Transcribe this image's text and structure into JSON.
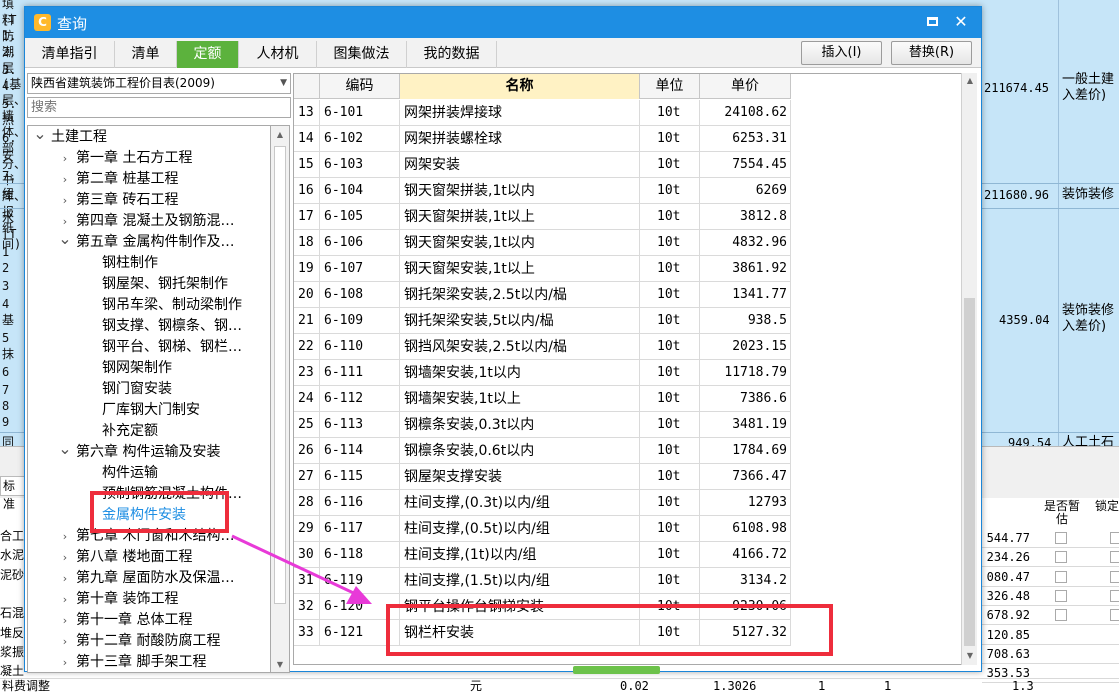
{
  "background": {
    "top_lines": [
      "填料防潮层(基层、墙体、部分、书库、报纸间)",
      "[T",
      "1.",
      "2.",
      "3.",
      "4.",
      "5.",
      "热",
      "6.",
      "安",
      "7.",
      "纽",
      "水",
      "[T",
      "1",
      "2",
      "3",
      "4",
      "基",
      "5",
      "抹",
      "6",
      "7",
      "8",
      "9",
      "同"
    ],
    "right_cells": [
      {
        "amount": "211674.45",
        "text": "一般土建\n入差价)"
      },
      {
        "amount": "211680.96",
        "text": "装饰装修"
      },
      {
        "amount": "4359.04",
        "text": "装饰装修\n入差价)"
      },
      {
        "amount": "949.54",
        "text": "人工土石"
      }
    ],
    "tab_label": "标准",
    "header_estimate": "是否暂\n估",
    "header_lock": "锁定",
    "lower_left": [
      "合工",
      "水泥",
      "泥砂",
      "",
      "石混",
      "堆反",
      "浆振",
      "凝土"
    ],
    "lower_amounts": [
      "544.77",
      "234.26",
      "080.47",
      "326.48",
      "678.92",
      "120.85",
      "708.63",
      "353.53"
    ],
    "bottom_row": {
      "name": "料费调整",
      "unit": "元",
      "qty": "0.02",
      "price": "1.3026",
      "c1": "1",
      "c2": "1",
      "end": "1.3"
    }
  },
  "dialog": {
    "title": "查询",
    "logo_glyph": "C",
    "minimize_glyph": "▭",
    "close_glyph": "✕",
    "tabs": [
      "清单指引",
      "清单",
      "定额",
      "人材机",
      "图集做法",
      "我的数据"
    ],
    "active_tab": "定额",
    "insert_label": "插入(I)",
    "replace_label": "替换(R)"
  },
  "left_panel": {
    "library": "陕西省建筑装饰工程价目表(2009)",
    "search_placeholder": "搜索",
    "tree": [
      {
        "label": "土建工程",
        "level": 0,
        "state": "open"
      },
      {
        "label": "第一章  土石方工程",
        "level": 1,
        "state": "closed"
      },
      {
        "label": "第二章  桩基工程",
        "level": 1,
        "state": "closed"
      },
      {
        "label": "第三章  砖石工程",
        "level": 1,
        "state": "closed"
      },
      {
        "label": "第四章  混凝土及钢筋混…",
        "level": 1,
        "state": "closed"
      },
      {
        "label": "第五章  金属构件制作及…",
        "level": 1,
        "state": "open"
      },
      {
        "label": "钢柱制作",
        "level": 2,
        "state": "leaf"
      },
      {
        "label": "钢屋架、钢托架制作",
        "level": 2,
        "state": "leaf"
      },
      {
        "label": "钢吊车梁、制动梁制作",
        "level": 2,
        "state": "leaf"
      },
      {
        "label": "钢支撑、钢檩条、钢…",
        "level": 2,
        "state": "leaf"
      },
      {
        "label": "钢平台、钢梯、钢栏…",
        "level": 2,
        "state": "leaf"
      },
      {
        "label": "钢网架制作",
        "level": 2,
        "state": "leaf"
      },
      {
        "label": "钢门窗安装",
        "level": 2,
        "state": "leaf"
      },
      {
        "label": "厂库钢大门制安",
        "level": 2,
        "state": "leaf"
      },
      {
        "label": "补充定额",
        "level": 2,
        "state": "leaf"
      },
      {
        "label": "第六章  构件运输及安装",
        "level": 1,
        "state": "open"
      },
      {
        "label": "构件运输",
        "level": 2,
        "state": "leaf"
      },
      {
        "label": "预制钢筋混凝土构件…",
        "level": 2,
        "state": "leaf"
      },
      {
        "label": "金属构件安装",
        "level": 2,
        "state": "selected"
      },
      {
        "label": "第七章  木门窗和木结构…",
        "level": 1,
        "state": "closed"
      },
      {
        "label": "第八章  楼地面工程",
        "level": 1,
        "state": "closed"
      },
      {
        "label": "第九章  屋面防水及保温…",
        "level": 1,
        "state": "closed"
      },
      {
        "label": "第十章  装饰工程",
        "level": 1,
        "state": "closed"
      },
      {
        "label": "第十一章  总体工程",
        "level": 1,
        "state": "closed"
      },
      {
        "label": "第十二章  耐酸防腐工程",
        "level": 1,
        "state": "closed"
      },
      {
        "label": "第十三章  脚手架工程",
        "level": 1,
        "state": "closed"
      }
    ]
  },
  "table": {
    "headers": {
      "code": "编码",
      "name": "名称",
      "unit": "单位",
      "price": "单价"
    },
    "rows": [
      {
        "idx": "13",
        "code": "6-101",
        "name": "网架拼装焊接球",
        "unit": "10t",
        "price": "24108.62"
      },
      {
        "idx": "14",
        "code": "6-102",
        "name": "网架拼装螺栓球",
        "unit": "10t",
        "price": "6253.31"
      },
      {
        "idx": "15",
        "code": "6-103",
        "name": "网架安装",
        "unit": "10t",
        "price": "7554.45"
      },
      {
        "idx": "16",
        "code": "6-104",
        "name": "钢天窗架拼装,1t以内",
        "unit": "10t",
        "price": "6269"
      },
      {
        "idx": "17",
        "code": "6-105",
        "name": "钢天窗架拼装,1t以上",
        "unit": "10t",
        "price": "3812.8"
      },
      {
        "idx": "18",
        "code": "6-106",
        "name": "钢天窗架安装,1t以内",
        "unit": "10t",
        "price": "4832.96"
      },
      {
        "idx": "19",
        "code": "6-107",
        "name": "钢天窗架安装,1t以上",
        "unit": "10t",
        "price": "3861.92"
      },
      {
        "idx": "20",
        "code": "6-108",
        "name": "钢托架梁安装,2.5t以内/榀",
        "unit": "10t",
        "price": "1341.77"
      },
      {
        "idx": "21",
        "code": "6-109",
        "name": "钢托架梁安装,5t以内/榀",
        "unit": "10t",
        "price": "938.5"
      },
      {
        "idx": "22",
        "code": "6-110",
        "name": "钢挡风架安装,2.5t以内/榀",
        "unit": "10t",
        "price": "2023.15"
      },
      {
        "idx": "23",
        "code": "6-111",
        "name": "钢墙架安装,1t以内",
        "unit": "10t",
        "price": "11718.79"
      },
      {
        "idx": "24",
        "code": "6-112",
        "name": "钢墙架安装,1t以上",
        "unit": "10t",
        "price": "7386.6"
      },
      {
        "idx": "25",
        "code": "6-113",
        "name": "钢檩条安装,0.3t以内",
        "unit": "10t",
        "price": "3481.19"
      },
      {
        "idx": "26",
        "code": "6-114",
        "name": "钢檩条安装,0.6t以内",
        "unit": "10t",
        "price": "1784.69"
      },
      {
        "idx": "27",
        "code": "6-115",
        "name": "钢屋架支撑安装",
        "unit": "10t",
        "price": "7366.47"
      },
      {
        "idx": "28",
        "code": "6-116",
        "name": "柱间支撑,(0.3t)以内/组",
        "unit": "10t",
        "price": "12793"
      },
      {
        "idx": "29",
        "code": "6-117",
        "name": "柱间支撑,(0.5t)以内/组",
        "unit": "10t",
        "price": "6108.98"
      },
      {
        "idx": "30",
        "code": "6-118",
        "name": "柱间支撑,(1t)以内/组",
        "unit": "10t",
        "price": "4166.72"
      },
      {
        "idx": "31",
        "code": "6-119",
        "name": "柱间支撑,(1.5t)以内/组",
        "unit": "10t",
        "price": "3134.2"
      },
      {
        "idx": "32",
        "code": "6-120",
        "name": "钢平台操作台钢梯安装",
        "unit": "10t",
        "price": "9230.06"
      },
      {
        "idx": "33",
        "code": "6-121",
        "name": "钢栏杆安装",
        "unit": "10t",
        "price": "5127.32"
      }
    ]
  },
  "colors": {
    "title_bar": "#1e8ee3",
    "active_tab": "#5cb23d",
    "name_header": "#fff2c4",
    "highlight": "#ee2d3c",
    "arrow": "#e83ad8",
    "selected_tree": "#1e8ee3"
  }
}
